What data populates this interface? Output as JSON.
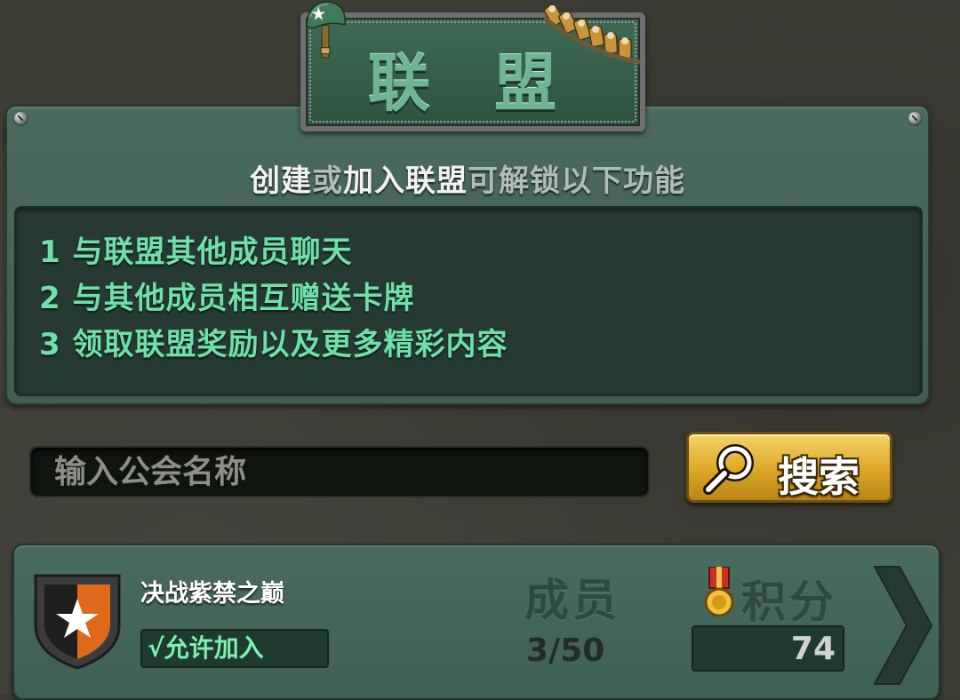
{
  "header": {
    "title": "联 盟"
  },
  "info": {
    "unlock_parts": [
      "创建",
      "或",
      "加入联盟",
      "可解锁以下功能"
    ],
    "features": [
      "1 与联盟其他成员聊天",
      "2 与其他成员相互赠送卡牌",
      "3 领取联盟奖励以及更多精彩内容"
    ]
  },
  "search": {
    "placeholder": "输入公会名称",
    "button_label": "搜索"
  },
  "alliance": {
    "name": "决战紫禁之巅",
    "join_status": "√允许加入",
    "members_label": "成员",
    "members_count": "3/50",
    "score_label": "积分",
    "score_value": "74"
  },
  "icons": {
    "helmet": "helmet-star-icon",
    "bullets": "bullet-belt-icon",
    "search": "magnifier-icon",
    "emblem": "star-shield-icon",
    "medal": "medal-icon",
    "next": "chevron-right-icon"
  },
  "colors": {
    "panel": "#4b6b5e",
    "feature_text": "#6ee0a8",
    "button_gold": "#dca727"
  }
}
